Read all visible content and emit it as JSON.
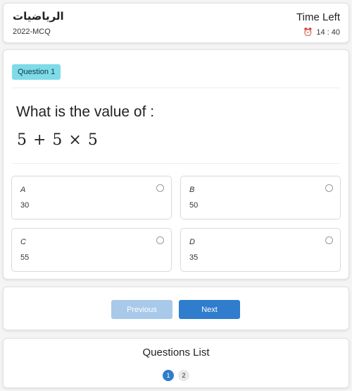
{
  "header": {
    "subject": "الرياضيات",
    "exam_code": "2022-MCQ",
    "time_left_label": "Time Left",
    "timer_icon": "alarm-clock-icon",
    "timer_value": "14 : 40"
  },
  "question": {
    "badge": "Question 1",
    "prompt": "What is the value of :",
    "expression": "5 + 5 × 5",
    "options": [
      {
        "letter": "A",
        "value": "30"
      },
      {
        "letter": "B",
        "value": "50"
      },
      {
        "letter": "C",
        "value": "55"
      },
      {
        "letter": "D",
        "value": "35"
      }
    ]
  },
  "navigation": {
    "previous_label": "Previous",
    "next_label": "Next"
  },
  "questions_list": {
    "title": "Questions List",
    "pages": [
      "1",
      "2"
    ],
    "active_page": "1"
  },
  "colors": {
    "accent": "#2f7dcc",
    "accent_disabled": "#a9c9ea",
    "badge_bg": "#7fdbe8",
    "page_bg": "#f4f4f5"
  }
}
